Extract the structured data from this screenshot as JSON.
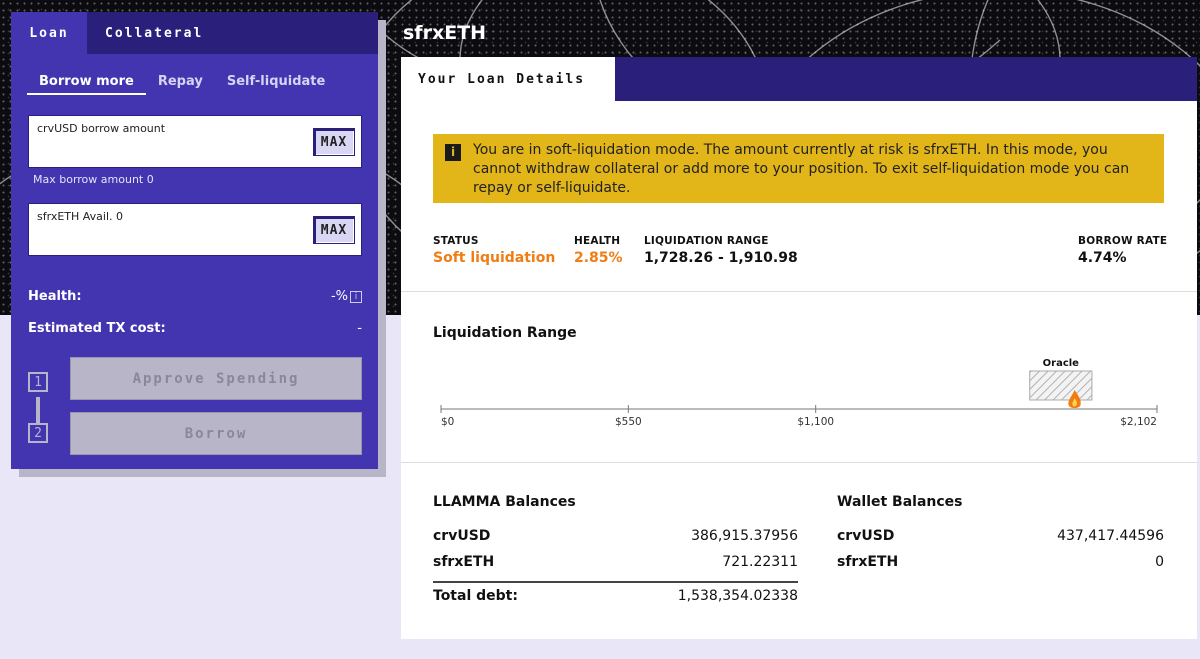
{
  "left_panel": {
    "tabs": [
      {
        "label": "Loan",
        "active": true
      },
      {
        "label": "Collateral",
        "active": false
      }
    ],
    "subtabs": [
      {
        "label": "Borrow more",
        "active": true
      },
      {
        "label": "Repay",
        "active": false
      },
      {
        "label": "Self-liquidate",
        "active": false
      }
    ],
    "borrow_input": {
      "label": "crvUSD borrow amount",
      "max_label": "MAX",
      "value": ""
    },
    "max_borrow_text": "Max borrow amount 0",
    "collateral_input": {
      "label": "sfrxETH Avail. 0",
      "max_label": "MAX",
      "value": ""
    },
    "health_label": "Health:",
    "health_value": "-%",
    "tx_cost_label": "Estimated TX cost:",
    "tx_cost_value": "-",
    "steps": [
      {
        "num": "1",
        "label": "Approve Spending"
      },
      {
        "num": "2",
        "label": "Borrow"
      }
    ]
  },
  "asset_title": "sfrxETH",
  "details_tab_label": "Your Loan Details",
  "alert_text": "You are in soft-liquidation mode. The amount currently at risk is sfrxETH. In this mode, you cannot withdraw collateral or add more to your position. To exit self-liquidation mode you can repay or self-liquidate.",
  "stats": {
    "status": {
      "label": "STATUS",
      "value": "Soft liquidation"
    },
    "health": {
      "label": "HEALTH",
      "value": "2.85%"
    },
    "liq_range": {
      "label": "LIQUIDATION RANGE",
      "value": "1,728.26 - 1,910.98"
    },
    "borrow_rate": {
      "label": "BORROW RATE",
      "value": "4.74%"
    }
  },
  "liquidation_range": {
    "title": "Liquidation Range",
    "oracle_label": "Oracle",
    "axis_min": 0,
    "axis_max": 2102,
    "range_low": 1728.26,
    "range_high": 1910.98,
    "oracle_price": 1860,
    "ticks": [
      {
        "value": 0,
        "label": "$0"
      },
      {
        "value": 550,
        "label": "$550"
      },
      {
        "value": 1100,
        "label": "$1,100"
      },
      {
        "value": 2102,
        "label": "$2,102"
      }
    ]
  },
  "llamma": {
    "title": "LLAMMA Balances",
    "rows": [
      {
        "label": "crvUSD",
        "value": "386,915.37956"
      },
      {
        "label": "sfrxETH",
        "value": "721.22311"
      }
    ],
    "total_label": "Total debt:",
    "total_value": "1,538,354.02338"
  },
  "wallet": {
    "title": "Wallet Balances",
    "rows": [
      {
        "label": "crvUSD",
        "value": "437,417.44596"
      },
      {
        "label": "sfrxETH",
        "value": "0"
      }
    ]
  },
  "colors": {
    "panel": "#4335b0",
    "panel_dark": "#2a1f7a",
    "alert": "#e2b519",
    "orange": "#f07c12"
  }
}
